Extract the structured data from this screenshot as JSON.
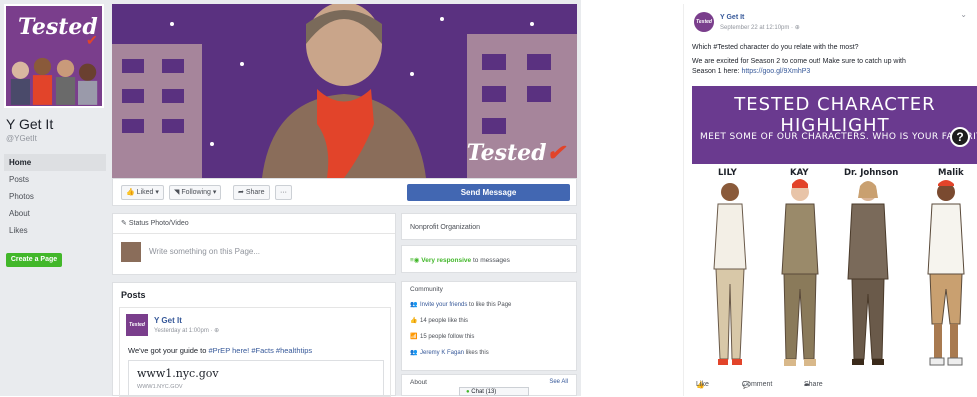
{
  "left_page": {
    "profile": {
      "brand_text": "Tested",
      "name": "Y Get It",
      "handle": "@YGetIt"
    },
    "nav": [
      "Home",
      "Posts",
      "Photos",
      "About",
      "Likes"
    ],
    "create_page": "Create a Page",
    "cover": {
      "logo_text": "Tested"
    },
    "actions": {
      "liked": "Liked ▾",
      "following": "Following ▾",
      "share": "Share",
      "more": "···",
      "send_message": "Send Message"
    },
    "composer": {
      "tabs": "Status   Photo/Video",
      "placeholder": "Write something on this Page..."
    },
    "posts": {
      "header": "Posts",
      "post": {
        "avatar_text": "Tested",
        "author": "Y Get It",
        "time": "Yesterday at 1:00pm · ⊕",
        "text_prefix": "We've got your guide to ",
        "hashtags": "#PrEP here! #Facts #healthtips",
        "link_title": "www1.nyc.gov",
        "link_domain": "WWW1.NYC.GOV"
      }
    },
    "right_col": {
      "category": "Nonprofit Organization",
      "responsive_label": "Very responsive",
      "responsive_rest": " to messages",
      "community_title": "Community",
      "community_rows": [
        {
          "icon": "👥",
          "link": "Invite your friends",
          "text": " to like this Page"
        },
        {
          "icon": "👍",
          "link": "",
          "text": "14 people like this"
        },
        {
          "icon": "📶",
          "link": "",
          "text": "15 people follow this"
        },
        {
          "icon": "👥",
          "link": "Jeremy K Fagan",
          "text": " likes this"
        }
      ],
      "about_title": "About",
      "see_all": "See All"
    },
    "chat": "Chat (13)"
  },
  "right_page": {
    "avatar_text": "Tested",
    "author": "Y Get It",
    "time": "September 22 at 12:10pm · ⊕",
    "more": "⌄",
    "line1": "Which #Tested character do you relate with the most?",
    "line2": "We are excited for Season 2 to come out! Make sure to catch up with",
    "line3_prefix": "Season 1 here: ",
    "line3_link": "https://goo.gl/9XmhP3",
    "banner_title": "TESTED CHARACTER HIGHLIGHT",
    "banner_sub": "MEET SOME OF OUR CHARACTERS.   WHO IS YOUR FAVORITE",
    "banner_q": "?",
    "characters": [
      "LILY",
      "KAY",
      "Dr. Johnson",
      "Malik"
    ],
    "actions": {
      "like": "Like",
      "comment": "Comment",
      "share": "Share"
    }
  },
  "colors": {
    "brand_purple": "#6a3a8f",
    "fb_blue": "#4267b2",
    "scarf_orange": "#e2442a",
    "green": "#42b72a"
  }
}
